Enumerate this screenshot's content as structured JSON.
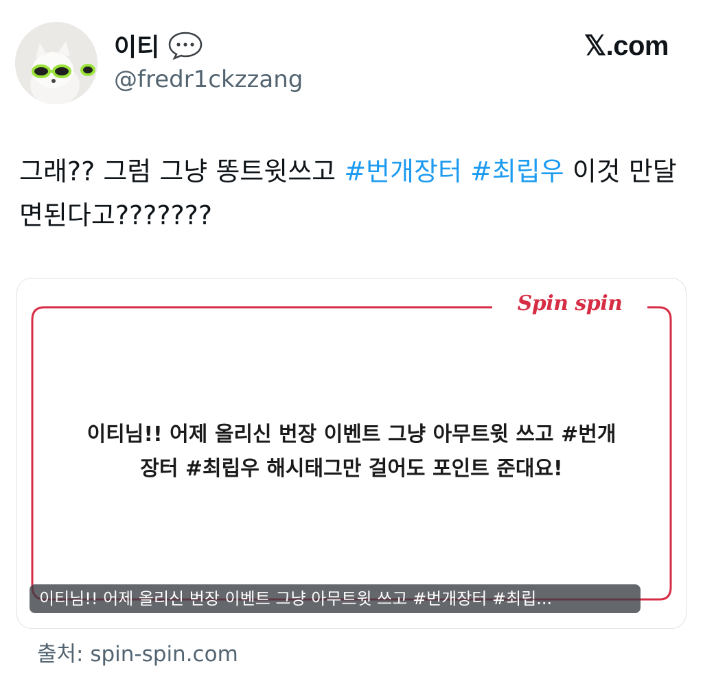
{
  "header": {
    "display_name": "이티",
    "handle": "@fredr1ckzzang",
    "brand": "𝕏.com"
  },
  "tweet": {
    "text_part1": "그래?? 그럼 그냥 똥트윗쓰고 ",
    "hashtag1": "#번개장터",
    "space": " ",
    "hashtag2": "#최립우",
    "text_part2": " 이것 만달면된다고???????"
  },
  "card": {
    "logo_text": "Spin spin",
    "message_line1": "이티님!! 어제 올리신 번장 이벤트 그냥 아무트윗 쓰고 #번개",
    "message_line2": "장터 #최립우 해시태그만 걸어도 포인트 준대요!",
    "caption": "이티님!! 어제 올리신 번장 이벤트 그냥 아무트윗 쓰고 #번개장터 #최립...",
    "frame_color": "#d62c44"
  },
  "source": "출처: spin-spin.com"
}
